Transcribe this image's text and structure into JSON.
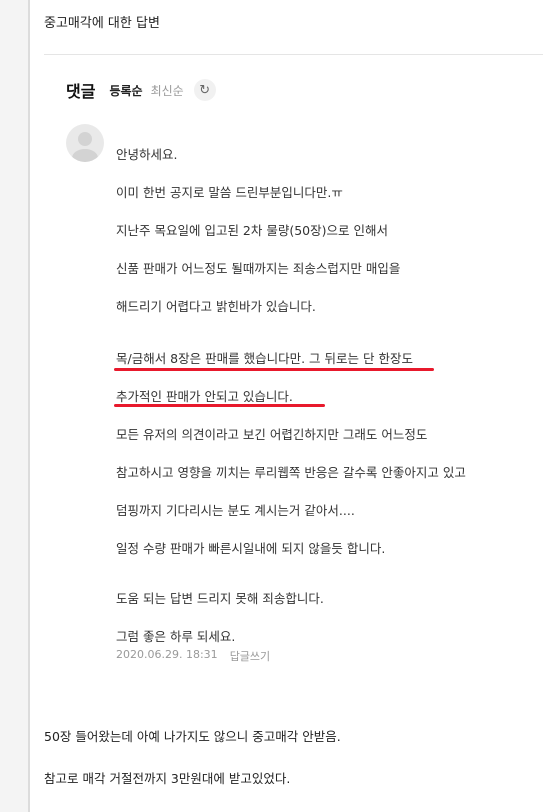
{
  "page": {
    "title": "중고매각에 대한 답변"
  },
  "comments": {
    "title": "댓글",
    "sort_registered": "등록순",
    "sort_latest": "최신순",
    "refresh_icon": "refresh-icon",
    "reply": {
      "lines": [
        "안녕하세요.",
        "이미 한번 공지로 말씀 드린부분입니다만.ㅠ",
        "지난주 목요일에 입고된 2차 물량(50장)으로 인해서",
        "신품 판매가 어느정도 될때까지는 죄송스럽지만 매입을",
        "해드리기 어렵다고 밝힌바가 있습니다.",
        "목/금해서 8장은 판매를 했습니다만. 그 뒤로는 단 한장도",
        "추가적인 판매가 안되고 있습니다.",
        "모든 유저의 의견이라고 보긴 어렵긴하지만 그래도 어느정도",
        "참고하시고 영향을 끼치는 루리웹쪽 반응은 갈수록 안좋아지고 있고",
        "덤핑까지 기다리시는 분도 계시는거 같아서....",
        "일정 수량 판매가 빠른시일내에 되지 않을듯 합니다.",
        "도움 되는 답변 드리지 못해 죄송합니다.",
        "그럼 좋은 하루 되세요."
      ],
      "date": "2020.06.29. 18:31",
      "reply_link": "답글쓰기"
    }
  },
  "post_body": [
    "50장 들어왔는데 아예 나가지도 않으니 중고매각 안받음.",
    "참고로 매각 거절전까지 3만원대에 받고있었다."
  ],
  "colors": {
    "highlight": "#e8192c",
    "muted": "#999999"
  }
}
